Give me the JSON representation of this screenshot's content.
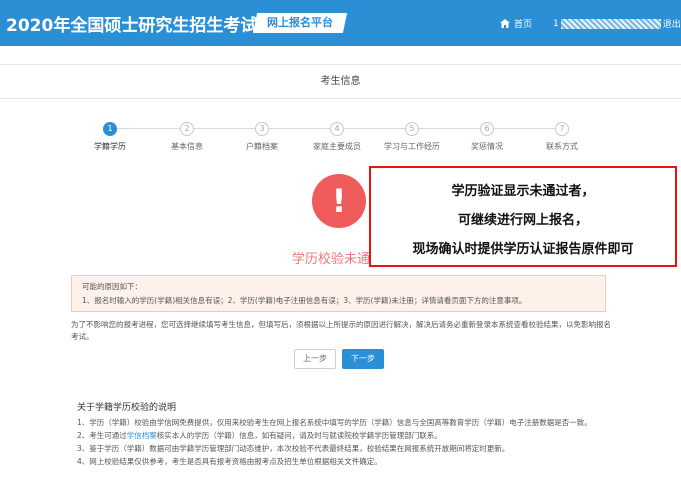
{
  "header": {
    "site_title": "2020年全国硕士研究生招生考试",
    "platform_tag": "网上报名平台",
    "home_label": "首页",
    "user_prefix": "1",
    "logout_label": "退出"
  },
  "page": {
    "title": "考生信息"
  },
  "steps": [
    {
      "number": "1",
      "label": "学籍学历",
      "active": true
    },
    {
      "number": "2",
      "label": "基本信息",
      "active": false
    },
    {
      "number": "3",
      "label": "户籍档案",
      "active": false
    },
    {
      "number": "4",
      "label": "家庭主要成员",
      "active": false
    },
    {
      "number": "5",
      "label": "学习与工作经历",
      "active": false
    },
    {
      "number": "6",
      "label": "奖惩情况",
      "active": false
    },
    {
      "number": "7",
      "label": "联系方式",
      "active": false
    }
  ],
  "result": {
    "icon_symbol": "!",
    "message": "学历校验未通过"
  },
  "reasons": {
    "title": "可能的原因如下：",
    "text": "1、报名时输入的学历(学籍)相关信息有误；2、学历(学籍)电子注册信息有误；3、学历(学籍)未注册；详情请看页面下方的注意事项。"
  },
  "notice": "为了不影响您的报考进程，您可选择继续填写考生信息，但填写后，须根据以上所提示的原因进行解决，解决后请务必重新登录本系统查看校验结果，以免影响报名考试。",
  "buttons": {
    "prev": "上一步",
    "next": "下一步"
  },
  "about": {
    "title": "关于学籍学历校验的说明",
    "item1": "1、学历（学籍）校验由学信网免费提供，仅用来校验考生在网上报名系统中填写的学历（学籍）信息与全国高等教育学历（学籍）电子注册数据是否一致。",
    "item2_before": "2、考生可通过",
    "item2_link": "学信档案",
    "item2_after": "核实本人的学历（学籍）信息，如有疑问，请及时与就读院校学籍学历管理部门联系。",
    "item3": "3、鉴于学历（学籍）数据可由学籍学历管理部门动态维护，本次校验不代表最终结果，校验结果在网报系统开放期间将定时更新。",
    "item4": "4、网上校验结果仅供参考，考生是否具有报考资格由报考点及招生单位根据相关文件确定。"
  },
  "overlay": {
    "line1": "学历验证显示未通过者，",
    "line2": "可继续进行网上报名，",
    "line3": "现场确认时提供学历认证报告原件即可"
  }
}
